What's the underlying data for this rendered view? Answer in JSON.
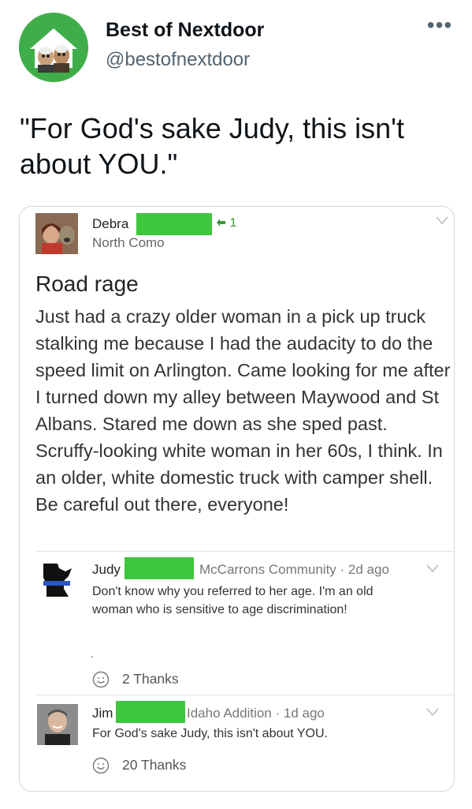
{
  "tweet": {
    "display_name": "Best of Nextdoor",
    "handle": "@bestofnextdoor",
    "more_label": "•••",
    "text": "\"For God's sake Judy, this isn't about YOU.\"",
    "avatar_icon": "muppets-house-avatar-icon"
  },
  "post": {
    "author": "Debra",
    "reply_count": "1",
    "location": "North Como",
    "title": "Road rage",
    "body": "Just had a crazy older woman in a pick up truck stalking me because I had the audacity to do the speed limit on Arlington. Came looking for me after I turned down my alley between Maywood and St Albans. Stared me down as she sped past. Scruffy-looking white woman in her 60s, I think. In an older, white domestic truck with camper shell. Be careful out there, everyone!"
  },
  "comments": [
    {
      "name": "Judy",
      "meta": "McCarrons Community · 2d ago",
      "body": "Don't know why you referred to her age. I'm an old woman who is sensitive to age discrimination!",
      "extra": ".",
      "thanks": "2 Thanks"
    },
    {
      "name": "Jim",
      "meta": "Idaho Addition · 1d ago",
      "body": "For God's sake Judy, this isn't about YOU.",
      "thanks": "20 Thanks"
    }
  ],
  "colors": {
    "redaction": "#3ec73e",
    "avatar_bg": "#3fae4a",
    "handle": "#536471",
    "border": "#cfd9de"
  }
}
